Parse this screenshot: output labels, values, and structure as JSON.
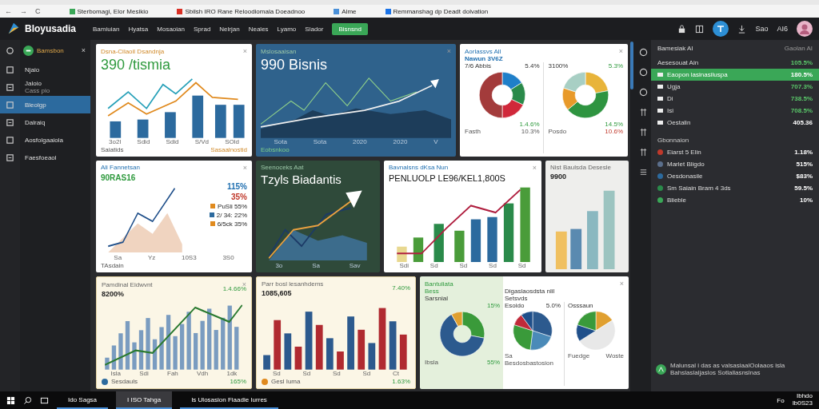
{
  "browser": {
    "controls": [
      "←",
      "→",
      "C"
    ]
  },
  "bookmarks": [
    {
      "label": "Sterbomagi, Elor Mesikio",
      "color": "#3aa757"
    },
    {
      "label": "Sbilsh IRO Rane Reloodiomala Doeadnoo",
      "color": "#d93025"
    },
    {
      "label": "Alme",
      "color": "#4a90d9"
    },
    {
      "label": "Remmanshag dp Deadt dolvation",
      "color": "#1a73e8"
    }
  ],
  "app": {
    "logo": "Bloyusadia",
    "nav": [
      "Bamiuian",
      "Hyatsa",
      "Mosaoian",
      "Sprad",
      "Nelrjan",
      "Neales",
      "Lyamo",
      "Slador"
    ],
    "action": "Bisnsnd",
    "user": [
      "Sao",
      "AI6"
    ]
  },
  "sidebar": {
    "header": "Bamsbon",
    "close": "×",
    "items": [
      {
        "label": "Njaio",
        "selected": false
      },
      {
        "label": "Jaloio",
        "sub": "Cass pio",
        "selected": false
      },
      {
        "label": "Bleolgp",
        "selected": true
      },
      {
        "label": "Dalraiq",
        "selected": false
      },
      {
        "label": "Aosfolgaaiola",
        "selected": false
      },
      {
        "label": "Faesfoeaol",
        "selected": false
      }
    ]
  },
  "rows": [
    [
      {
        "kind": "combo",
        "title": "Dsna-Cilaoil Dsandnja",
        "headline": "390 /tismia",
        "close": "×",
        "axis": [
          "3o2l",
          "Sdid",
          "Sdid",
          "S/Vd",
          "SOld"
        ],
        "footer": [
          "Saiatids",
          "Sasaalnostid"
        ]
      },
      {
        "kind": "mountain",
        "title": "Mslosaaisan",
        "headline": "990 Bisnis",
        "close": "×",
        "axis": [
          "Sota",
          "Sota",
          "2020",
          "2020",
          "V"
        ],
        "footer": [
          "Eobsnkoo"
        ]
      },
      {
        "kind": "donuts",
        "title": "Aorlassvs All",
        "subtitle": "Nawun 3V6Z",
        "close": "×",
        "stats": [
          {
            "text": "7/6 Abbis"
          },
          {
            "text": "5.4%"
          },
          {
            "text": "3100%"
          },
          {
            "text": "5.3%"
          },
          {
            "text": "1.4.6%"
          },
          {
            "text": "14.5%"
          }
        ],
        "footer": [
          "Fasth",
          "10.3%",
          "Posdo",
          "10.6%"
        ]
      }
    ],
    [
      {
        "kind": "area",
        "title": "Ali Fannetsan",
        "headline": "90RAS16",
        "close": "×",
        "stats": [
          {
            "text": "115%"
          },
          {
            "text": "35%"
          },
          {
            "text": "PuSli 55%",
            "color": "#e08a1e"
          },
          {
            "text": "2/ 34: 22%",
            "color": "#2c6a9e"
          },
          {
            "text": "6/5ck 35%",
            "color": "#e08a1e"
          }
        ],
        "axis": [
          "Sa",
          "Yz",
          "10S3",
          "3S0"
        ],
        "footer": [
          "TAsdain"
        ]
      },
      {
        "kind": "arrow",
        "title": "Seenoceks Aat",
        "headline": "Tzyls Biadantis",
        "axis": [
          "3o",
          "Sa",
          "Sav"
        ]
      },
      {
        "kind": "barline",
        "title": "Bavnalsns dKsa Nun",
        "headline": "PENLUOLP LE96/KEL1,800S",
        "close": "×",
        "axis": [
          "Sdi",
          "Sd",
          "Sd",
          "Sd",
          "Sd"
        ]
      },
      {
        "kind": "bars",
        "title": "Nist Baulsda Desesle",
        "headline": "9900"
      }
    ],
    [
      {
        "kind": "dense",
        "title": "Pamdinal Eidwvnt",
        "headline": "8200%",
        "close": "×",
        "stats": [
          {
            "text": "1.4.66%"
          }
        ],
        "axis": [
          "Isla",
          "Sdi",
          "Fah",
          "Vdh",
          "1dk"
        ],
        "footer": [
          "Sesdauls",
          "165%"
        ],
        "color": "#2c6a9e"
      },
      {
        "kind": "grouped",
        "title": "Parr bosl lesanhdems",
        "headline": "1085,605",
        "stats": [
          {
            "text": "7.40%"
          }
        ],
        "axis": [
          "Sd",
          "Sd",
          "Sd",
          "Sd",
          "Ct"
        ],
        "footer": [
          "Gesl Iuma",
          "1.63%"
        ],
        "color": "#e08a1e"
      },
      {
        "kind": "pies",
        "title": "Bantuliata",
        "close": "×",
        "stats": [
          {
            "text": "Bess"
          },
          {
            "text": "Sarsnial"
          },
          {
            "text": "15%"
          },
          {
            "text": "Digaslaosdsta nlil"
          },
          {
            "text": "Setsvds"
          },
          {
            "text": "Esoido"
          },
          {
            "text": "5.0%"
          },
          {
            "text": "Osssaun"
          }
        ],
        "footer": [
          "Ibsla",
          "55%",
          "Sa Besdosbastosion",
          "Fuedge",
          "Woste"
        ]
      }
    ]
  ],
  "panel": {
    "title": "Bamesiak AI",
    "tag": "Gaolan AI",
    "rows": [
      {
        "label": "Aesesouat Ain",
        "value": "105.5%",
        "selected": false
      },
      {
        "label": "Eaopon lasinasiluspa",
        "value": "180.5%",
        "selected": true
      },
      {
        "label": "Ugja",
        "value": "707.3%",
        "selected": false
      },
      {
        "label": "Di",
        "value": "738.5%",
        "selected": false
      },
      {
        "label": "Isi",
        "value": "708.5%",
        "selected": false
      },
      {
        "label": "Oestalin",
        "value": "405.36",
        "selected": false
      }
    ],
    "section": "Gbonnaion",
    "items": [
      {
        "label": "Eiarst 5 Elin",
        "value": "1.18%",
        "color": "#c0392b"
      },
      {
        "label": "Marlet Bligdo",
        "value": "515%",
        "color": "#5b6f8c"
      },
      {
        "label": "Oesdonasile",
        "value": "$83%",
        "color": "#2c6a9e"
      },
      {
        "label": "Sm Saiain Bram 4 3ds",
        "value": "59.5%",
        "color": "#2a8a4a"
      },
      {
        "label": "Blieble",
        "value": "10%",
        "color": "#3aa757"
      }
    ],
    "note": "Malunsal i das as valsasiaalOolaaos isla Bahslaslaljaslos Sotlallasnslnas"
  },
  "taskbar": {
    "apps": [
      {
        "label": "Ido Sagsa",
        "selected": false
      },
      {
        "label": "I ISO Tahga",
        "selected": true
      },
      {
        "label": "Is Ulosasion Fiaadie Iurres",
        "selected": false
      }
    ],
    "tray": "Fo",
    "time": "Ibhdo",
    "date": "Ib0S23"
  }
}
